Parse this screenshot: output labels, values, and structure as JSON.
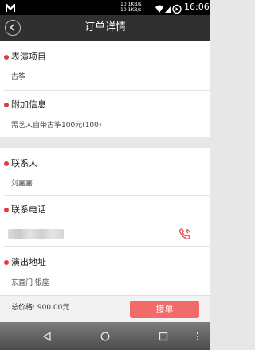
{
  "status_bar": {
    "speed_up": "10.1KB/s",
    "speed_down": "10.1KB/s",
    "time": "16:06"
  },
  "header": {
    "title": "订单详情"
  },
  "sections": {
    "program": {
      "label": "表演项目",
      "value": "古筝"
    },
    "extra_info": {
      "label": "附加信息",
      "value": "需艺人自带古筝100元(100)"
    },
    "contact": {
      "label": "联系人",
      "value": "刘嘉嘉"
    },
    "phone": {
      "label": "联系电话"
    },
    "address": {
      "label": "演出地址",
      "value": "东直门 银座"
    }
  },
  "footer": {
    "total_label": "总价格: 900.00元",
    "order_button": "接单"
  },
  "colors": {
    "accent_red": "#e53935",
    "button_red": "#f26b6b",
    "header_bg": "#303030"
  },
  "icons": {
    "back": "back-arrow-icon",
    "phone": "phone-call-icon"
  }
}
